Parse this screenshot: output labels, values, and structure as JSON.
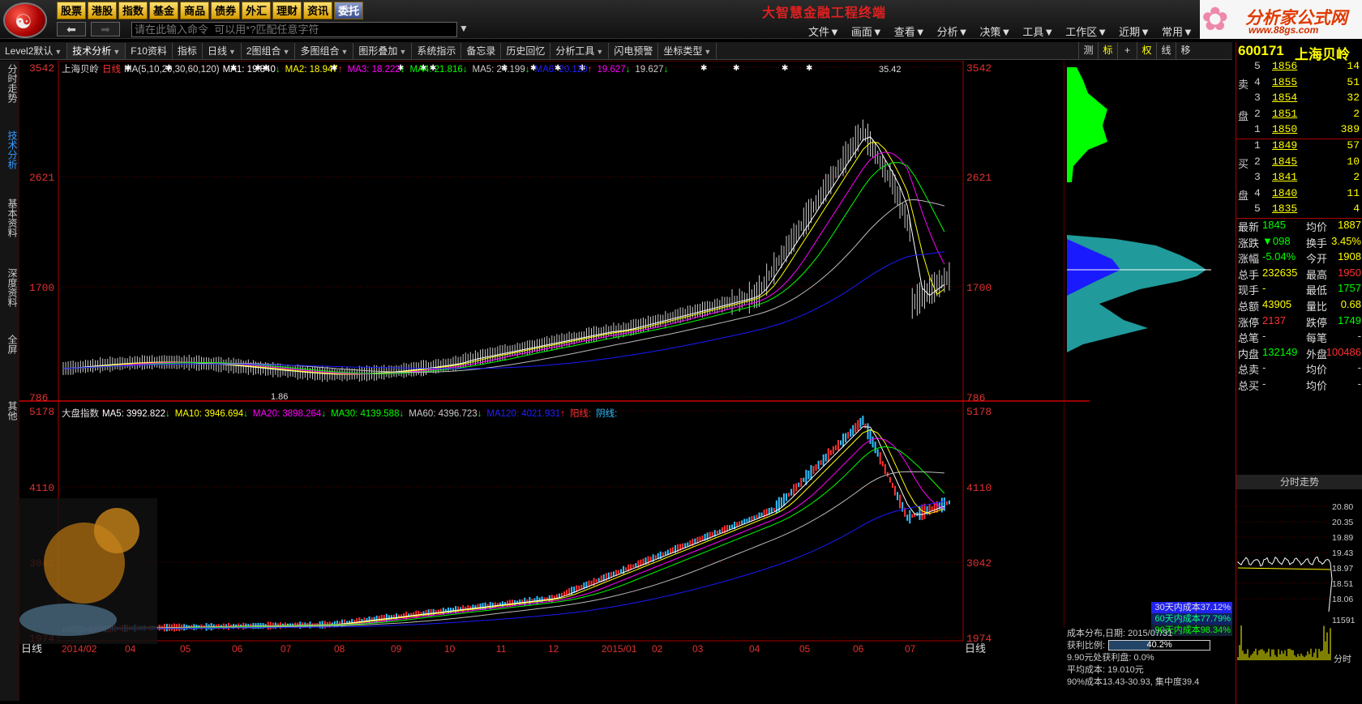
{
  "app_title": "大智慧金融工程终端",
  "market_tabs": [
    "股票",
    "港股",
    "指数",
    "基金",
    "商品",
    "债券",
    "外汇",
    "理财",
    "资讯",
    "委托"
  ],
  "active_market_tab": "委托",
  "command_input": {
    "placeholder": "请在此输入命令  可以用*?匹配任意字符"
  },
  "menus": [
    "文件▼",
    "画面▼",
    "查看▼",
    "分析▼",
    "决策▼",
    "工具▼",
    "工作区▼",
    "近期▼",
    "常用▼"
  ],
  "brand": {
    "name": "分析家公式网",
    "url": "www.88gs.com"
  },
  "toolbar": {
    "items": [
      "Level2默认",
      "技术分析",
      "F10资料",
      "指标",
      "日线",
      "2图组合",
      "多图组合",
      "图形叠加",
      "系统指示",
      "备忘录",
      "历史回忆",
      "分析工具",
      "闪电预警",
      "坐标类型"
    ],
    "right_items": [
      "测",
      "标",
      "+",
      "权",
      "线",
      "移"
    ]
  },
  "side_tabs": [
    "分时走势",
    "技术分析",
    "基本资料",
    "深度资料",
    "全屏",
    "其他"
  ],
  "upper_chart": {
    "stock_name": "上海贝岭",
    "period": "日线",
    "ma_label": "MA(5,10,20,30,60,120)",
    "ma_values": [
      {
        "label": "MA1: 19.840",
        "arrow": "↓",
        "color": "#ffffff"
      },
      {
        "label": "MA2: 18.947",
        "arrow": "↑",
        "color": "#ffff00"
      },
      {
        "label": "MA3: 18.222",
        "arrow": "↓",
        "color": "#ff00ff"
      },
      {
        "label": "MA4: 21.816",
        "arrow": "↓",
        "color": "#00ff00"
      },
      {
        "label": "MA5: 24.199",
        "arrow": "↓",
        "color": "#cccccc"
      },
      {
        "label": "MA6: 20.120",
        "arrow": "↑",
        "color": "#2020ff"
      },
      {
        "label": "19.627",
        "arrow": "↓",
        "color": "#ff00ff"
      },
      {
        "label": "19.627",
        "arrow": "↓",
        "color": "#cccccc"
      }
    ],
    "y_ticks": [
      "3542",
      "2621",
      "1700",
      "786"
    ],
    "high_label": "35.42",
    "low_label": "1.86"
  },
  "lower_chart": {
    "name": "大盘指数",
    "ma_values": [
      {
        "label": "MA5: 3992.822",
        "arrow": "↓",
        "color": "#ffffff"
      },
      {
        "label": "MA10: 3946.694",
        "arrow": "↓",
        "color": "#ffff00"
      },
      {
        "label": "MA20: 3898.264",
        "arrow": "↓",
        "color": "#ff00ff"
      },
      {
        "label": "MA30: 4139.588",
        "arrow": "↓",
        "color": "#00ff00"
      },
      {
        "label": "MA60: 4396.723",
        "arrow": "↓",
        "color": "#cccccc"
      },
      {
        "label": "MA120: 4021.931",
        "arrow": "↑",
        "color": "#2020ff"
      },
      {
        "label": "阳线:",
        "arrow": "",
        "color": "#ff3030"
      },
      {
        "label": "阴线:",
        "arrow": "",
        "color": "#30c0ff"
      }
    ],
    "y_ticks": [
      "5178",
      "4110",
      "3042",
      "1974"
    ]
  },
  "x_axis": {
    "period": "日线",
    "labels": [
      "2014/02",
      "04",
      "05",
      "06",
      "07",
      "08",
      "09",
      "10",
      "11",
      "12",
      "2015/01",
      "02",
      "03",
      "04",
      "05",
      "06",
      "07"
    ]
  },
  "cost_distribution": {
    "title": "成本分布,日期: 2015/07/31",
    "profit_label": "获利比例:",
    "profit_ratio": "40.2%",
    "profit_fraction": 0.402,
    "line1": "9.90元处获利盘: 0.0%",
    "line2": "平均成本: 19.010元",
    "line3": "90%成本13.43-30.93, 集中度39.4",
    "legend_a": "30天内成本37.12%",
    "legend_b": "60天内成本77.79%",
    "legend_c": "90天内成本98.34%"
  },
  "quote": {
    "code": "600171",
    "name": "上海贝岭",
    "sell_label": [
      "卖",
      "盘"
    ],
    "buy_label": [
      "买",
      "盘"
    ],
    "sells": [
      {
        "level": "5",
        "price": "1856",
        "vol": "14"
      },
      {
        "level": "4",
        "price": "1855",
        "vol": "51"
      },
      {
        "level": "3",
        "price": "1854",
        "vol": "32"
      },
      {
        "level": "2",
        "price": "1851",
        "vol": "2"
      },
      {
        "level": "1",
        "price": "1850",
        "vol": "389"
      }
    ],
    "buys": [
      {
        "level": "1",
        "price": "1849",
        "vol": "57"
      },
      {
        "level": "2",
        "price": "1845",
        "vol": "10"
      },
      {
        "level": "3",
        "price": "1841",
        "vol": "2"
      },
      {
        "level": "4",
        "price": "1840",
        "vol": "11"
      },
      {
        "level": "5",
        "price": "1835",
        "vol": "4"
      }
    ],
    "stats": [
      {
        "l1": "最新",
        "v1": "1845",
        "c1": "#00ff00",
        "l2": "均价",
        "v2": "1887",
        "c2": "#ff0"
      },
      {
        "l1": "涨跌",
        "v1": "▼098",
        "c1": "#00ff00",
        "l2": "换手",
        "v2": "3.45%",
        "c2": "#ff0"
      },
      {
        "l1": "涨幅",
        "v1": "-5.04%",
        "c1": "#00ff00",
        "l2": "今开",
        "v2": "1908",
        "c2": "#ff0"
      },
      {
        "l1": "总手",
        "v1": "232635",
        "c1": "#ff0",
        "l2": "最高",
        "v2": "1950",
        "c2": "#ff3030"
      },
      {
        "l1": "现手",
        "v1": "-",
        "c1": "#ff0",
        "l2": "最低",
        "v2": "1757",
        "c2": "#00ff00"
      },
      {
        "l1": "总额",
        "v1": "43905",
        "c1": "#ff0",
        "l2": "量比",
        "v2": "0.68",
        "c2": "#ff0"
      },
      {
        "l1": "涨停",
        "v1": "2137",
        "c1": "#ff3030",
        "l2": "跌停",
        "v2": "1749",
        "c2": "#00ff00"
      },
      {
        "l1": "总笔",
        "v1": "-",
        "c1": "#ccc",
        "l2": "每笔",
        "v2": "-",
        "c2": "#ccc"
      },
      {
        "l1": "内盘",
        "v1": "132149",
        "c1": "#00ff00",
        "l2": "外盘",
        "v2": "100486",
        "c2": "#ff3030"
      },
      {
        "l1": "总卖",
        "v1": "-",
        "c1": "#ccc",
        "l2": "均价",
        "v2": "-",
        "c2": "#ccc"
      },
      {
        "l1": "总买",
        "v1": "-",
        "c1": "#ccc",
        "l2": "均价",
        "v2": "-",
        "c2": "#ccc"
      }
    ],
    "mini_title": "分时走势",
    "mini_y": [
      "20.80",
      "20.35",
      "19.89",
      "19.43",
      "18.97",
      "18.51",
      "18.06"
    ],
    "mini_vol": "11591",
    "mini_vol_label": "分时"
  },
  "colors": {
    "up": "#ff3030",
    "down": "#30c0ff",
    "ma1": "#ffffff",
    "ma2": "#ffff00",
    "ma3": "#ff00ff",
    "ma4": "#00ff00",
    "ma5": "#bbbbbb",
    "ma6": "#1a1aff",
    "grid": "#a00000"
  }
}
